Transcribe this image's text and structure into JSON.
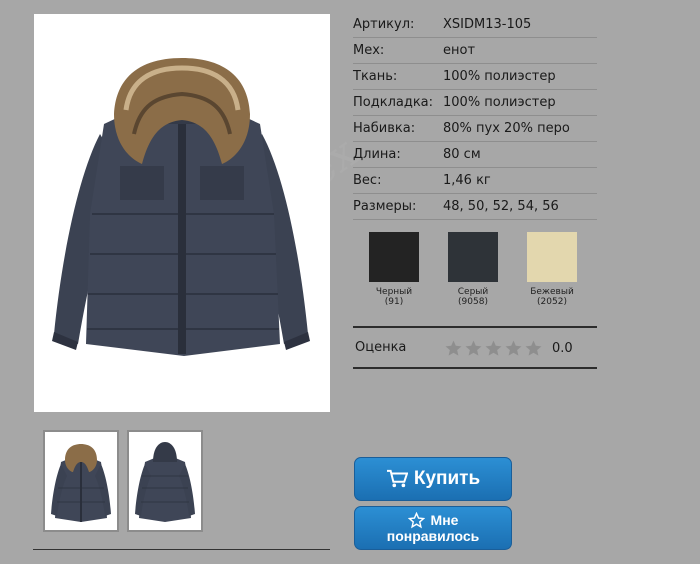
{
  "specs": [
    {
      "label": "Артикул:",
      "value": "XSIDM13-105"
    },
    {
      "label": "Мех:",
      "value": "енот"
    },
    {
      "label": "Ткань:",
      "value": "100% полиэстер"
    },
    {
      "label": "Подкладка:",
      "value": "100% полиэстер"
    },
    {
      "label": "Набивка:",
      "value": "80% пух 20% перо"
    },
    {
      "label": "Длина:",
      "value": "80 см"
    },
    {
      "label": "Вес:",
      "value": "1,46 кг"
    },
    {
      "label": "Размеры:",
      "value": "48, 50, 52, 54, 56"
    }
  ],
  "colors": [
    {
      "name": "Черный",
      "code": "(91)",
      "hex": "#232323"
    },
    {
      "name": "Серый",
      "code": "(9058)",
      "hex": "#2e3338"
    },
    {
      "name": "Бежевый",
      "code": "(2052)",
      "hex": "#e3d7ae"
    }
  ],
  "rating": {
    "label": "Оценка",
    "value": "0.0",
    "stars_filled": 0,
    "stars_total": 5
  },
  "buttons": {
    "buy": "Купить",
    "like_line1": "Мне",
    "like_line2": "понравилось"
  },
  "icons": {
    "buy": "cart-icon",
    "like": "star-outline-icon"
  },
  "watermark": "Stiltsex"
}
